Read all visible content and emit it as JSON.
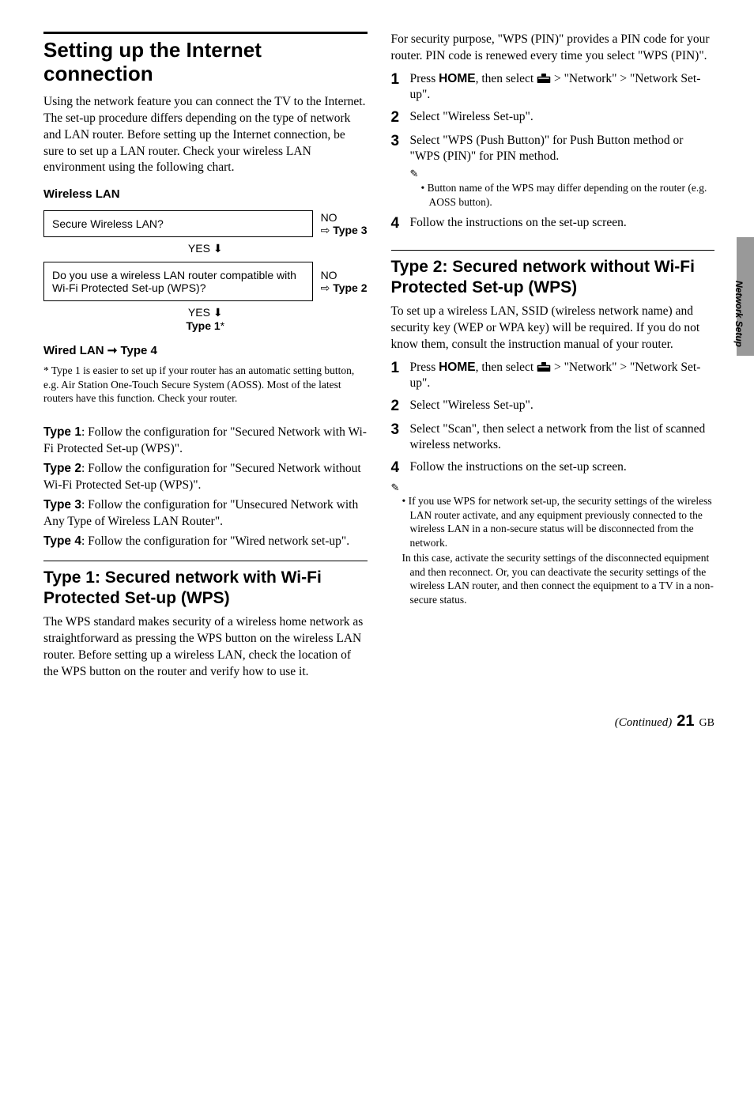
{
  "left": {
    "h1": "Setting up the Internet connection",
    "intro": "Using the network feature you can connect the TV to the Internet. The set-up procedure differs depending on the type of network and LAN router. Before setting up the Internet connection, be sure to set up a LAN router. Check your wireless LAN environment using the following chart.",
    "wlan_heading": "Wireless LAN",
    "box1": "Secure Wireless LAN?",
    "no": "NO",
    "type3": "Type 3",
    "yes": "YES",
    "box2": "Do you use a wireless LAN router compatible with Wi-Fi Protected Set-up (WPS)?",
    "type2": "Type 2",
    "type1": "Type 1",
    "star": "*",
    "wired_heading_pre": "Wired LAN ",
    "wired_heading_post": " Type 4",
    "footnote": "* Type 1 is easier to set up if your router has an automatic setting button, e.g. Air Station One-Touch Secure System (AOSS). Most of the latest routers have this function. Check your router.",
    "t1_label": "Type 1",
    "t1_text": ": Follow the configuration for \"Secured Network with Wi-Fi Protected Set-up (WPS)\".",
    "t2_label": "Type 2",
    "t2_text": ": Follow the configuration for \"Secured Network without Wi-Fi Protected Set-up (WPS)\".",
    "t3_label": "Type 3",
    "t3_text": ": Follow the configuration for \"Unsecured Network with Any Type of Wireless LAN Router\".",
    "t4_label": "Type 4",
    "t4_text": ": Follow the configuration for \"Wired network set-up\".",
    "h2a": "Type 1: Secured network with Wi-Fi Protected Set-up (WPS)",
    "h2a_text": "The WPS standard makes security of a wireless home network as straightforward as pressing the WPS button on the wireless LAN router. Before setting up a wireless LAN, check the location of the WPS button on the router and verify how to use it."
  },
  "right": {
    "intro": "For security purpose, \"WPS (PIN)\" provides a PIN code for your router. PIN code is renewed every time you select \"WPS (PIN)\".",
    "s1a": "Press ",
    "home": "HOME",
    "s1b": ", then select ",
    "s1c": " > \"Network\" > \"Network Set-up\".",
    "s2": "Select \"Wireless Set-up\".",
    "s3": "Select \"WPS (Push Button)\" for Push Button method or \"WPS (PIN)\" for PIN method.",
    "s3_note": "Button name of the WPS may differ depending on the router (e.g. AOSS button).",
    "s4": "Follow the instructions on the set-up screen.",
    "h2b": "Type 2: Secured network without Wi-Fi Protected Set-up (WPS)",
    "h2b_text": "To set up a wireless LAN, SSID (wireless network name) and security key (WEP or WPA key) will be required. If you do not know them, consult the instruction manual of your router.",
    "b3": "Select \"Scan\", then select a network from the list of scanned wireless networks.",
    "bottom_note": "If you use WPS for network set-up, the security settings of the wireless LAN router activate, and any equipment previously connected to the wireless LAN in a non-secure status will be disconnected from the network.",
    "bottom_note2": "In this case, activate the security settings of the disconnected equipment and then reconnect. Or, you can deactivate the security settings of the wireless LAN router, and then connect the equipment to a TV in a non-secure status."
  },
  "side_tab": "Network Setup",
  "footer": {
    "cont": "(Continued)",
    "page": "21",
    "gb": "GB"
  },
  "nums": {
    "n1": "1",
    "n2": "2",
    "n3": "3",
    "n4": "4"
  }
}
